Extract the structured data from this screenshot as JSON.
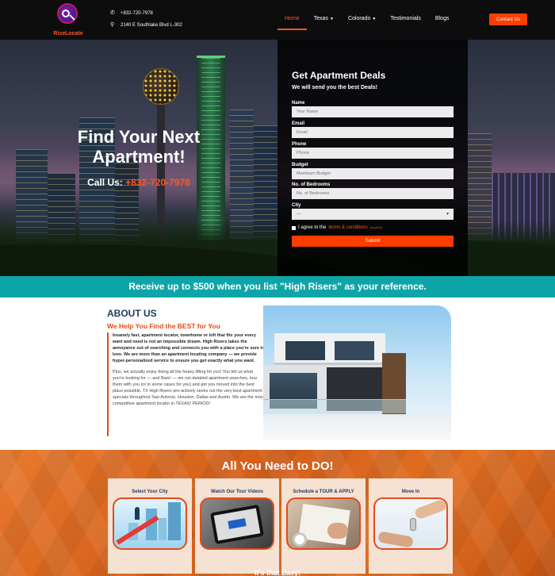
{
  "header": {
    "logo_text": "RiseLocate",
    "phone": "+832-720-7978",
    "address": "2140 E Southlake Blvd L-302",
    "nav": [
      {
        "label": "Home",
        "active": true,
        "dropdown": false
      },
      {
        "label": "Texas",
        "active": false,
        "dropdown": true
      },
      {
        "label": "Colorado",
        "active": false,
        "dropdown": true
      },
      {
        "label": "Testimonials",
        "active": false,
        "dropdown": false
      },
      {
        "label": "Blogs",
        "active": false,
        "dropdown": false
      }
    ],
    "contact_button": "Contact Us",
    "icons": {
      "phone": "phone-icon",
      "location": "location-pin-icon",
      "dropdown": "chevron-down-icon"
    }
  },
  "hero": {
    "title": "Find Your Next Apartment!",
    "call_label": "Call Us: ",
    "call_phone": "+832-720-7978"
  },
  "form": {
    "title": "Get Apartment Deals",
    "subtitle": "We will send you the best Deals!",
    "fields": {
      "name": {
        "label": "Name",
        "placeholder": "Your Name"
      },
      "email": {
        "label": "Email",
        "placeholder": "Email"
      },
      "phone": {
        "label": "Phone",
        "placeholder": "Phone"
      },
      "budget": {
        "label": "Budget",
        "placeholder": "Maximum Budget"
      },
      "bedrooms": {
        "label": "No. of Bedrooms",
        "placeholder": "No. of Bedrooms"
      },
      "city": {
        "label": "City",
        "value": "---"
      }
    },
    "agree_prefix": "I agree to the ",
    "agree_link": "terms & conditions",
    "agree_required": "(required)",
    "submit": "Submit"
  },
  "promo": {
    "text": "Receive up to $500 when you list \"High Risers\" as your reference."
  },
  "about": {
    "title": "ABOUT US",
    "subtitle": "We Help You Find the BEST for You",
    "bold_text": "Insanely fast, apartment locator, townhome or loft that fits your every want and need is not an impossible dream. High Risers takes the annoyance out of searching and connects you with a place you're sure to love. We are more than an apartment locating company — we provide hyper-personalized service to ensure you get exactly what you want.",
    "regular_text": "Plus, we actually enjoy doing all the heavy lifting for you! You tell us what you're looking for — and Bam! — we run detailed apartment searches, tour them with you (or in some cases for you) and get you moved into the best place possible. TX High Risers pro-actively seeks out the very best apartment specials throughout San Antonio, Houston, Dallas and Austin. We are the most competitive apartment locator in TEXAS! PERIOD!"
  },
  "steps": {
    "title": "All You Need to DO!",
    "items": [
      {
        "label": "Select Your City"
      },
      {
        "label": "Watch Our Tour Videos"
      },
      {
        "label": "Schedule a TOUR & APPLY"
      },
      {
        "label": "Move In"
      }
    ],
    "footer": "It's that Easy!"
  },
  "colors": {
    "accent": "#ff3d00",
    "teal": "#0ea5a8",
    "navy": "#1b3b5f",
    "header_bg": "#0d0d0d"
  }
}
